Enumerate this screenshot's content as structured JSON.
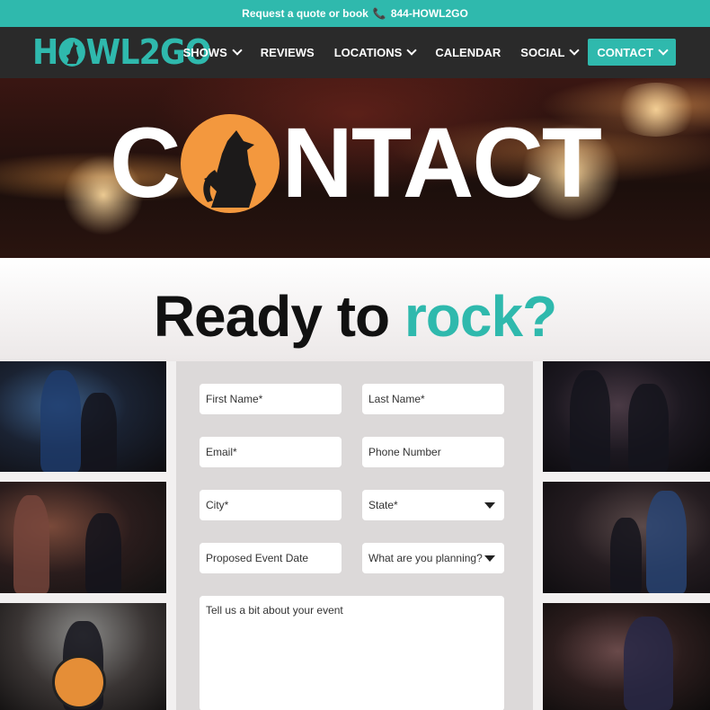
{
  "topbar": {
    "text": "Request a quote or book",
    "phone_icon": "phone-icon",
    "phone": "844-HOWL2GO"
  },
  "brand": {
    "name_left": "H",
    "name_right": "WL2GO",
    "logo_icon": "howling-wolf-icon",
    "accent_color": "#2fb9ad",
    "orange_color": "#f3983e"
  },
  "nav": {
    "items": [
      {
        "label": "SHOWS",
        "dropdown": true
      },
      {
        "label": "REVIEWS",
        "dropdown": false
      },
      {
        "label": "LOCATIONS",
        "dropdown": true
      },
      {
        "label": "CALENDAR",
        "dropdown": false
      },
      {
        "label": "SOCIAL",
        "dropdown": true
      },
      {
        "label": "CONTACT",
        "dropdown": true,
        "active": true
      }
    ]
  },
  "hero": {
    "title_left": "C",
    "title_right": "NTACT"
  },
  "band": {
    "heading_plain": "Ready to ",
    "heading_accent": "rock?"
  },
  "form": {
    "first_name": "First Name*",
    "last_name": "Last Name*",
    "email": "Email*",
    "phone": "Phone Number",
    "city": "City*",
    "state": "State*",
    "event_date": "Proposed Event Date",
    "planning": "What are you planning?",
    "message": "Tell us a bit about your event"
  }
}
